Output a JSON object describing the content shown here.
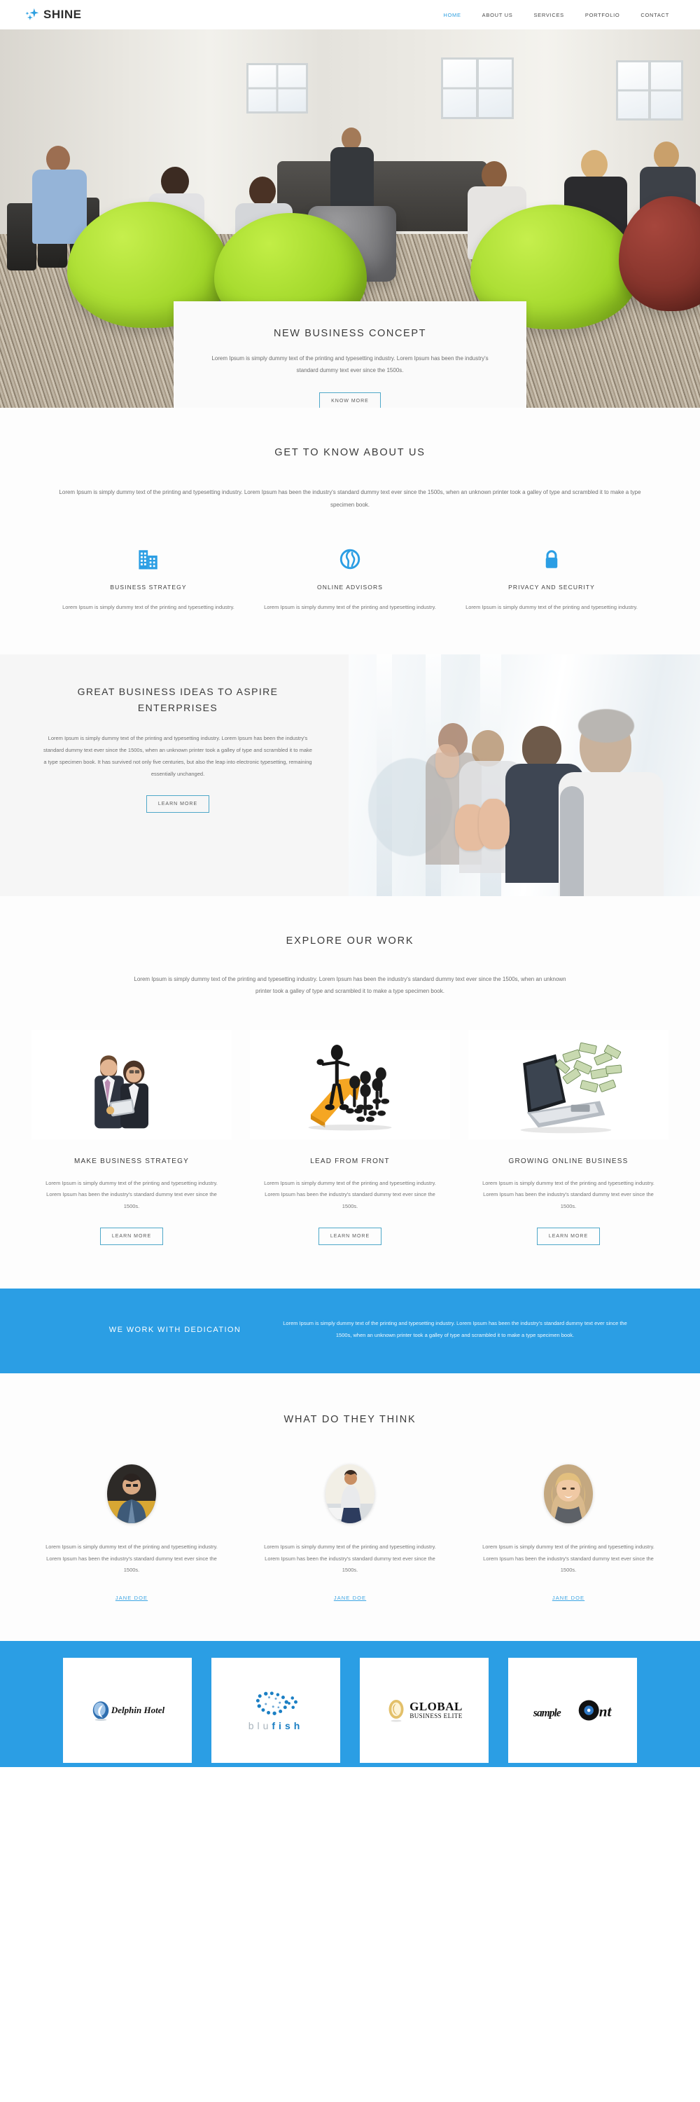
{
  "theme": {
    "accent": "#2b9ee4",
    "accent_light": "#3ea6e4",
    "outline": "#4fa8c9",
    "text_dark": "#3a3a3a",
    "text_muted": "#767676"
  },
  "header": {
    "brand": "SHINE",
    "nav": [
      {
        "label": "HOME",
        "active": true
      },
      {
        "label": "ABOUT US",
        "active": false
      },
      {
        "label": "SERVICES",
        "active": false
      },
      {
        "label": "PORTFOLIO",
        "active": false
      },
      {
        "label": "CONTACT",
        "active": false
      }
    ]
  },
  "hero": {
    "title": "NEW BUSINESS CONCEPT",
    "body": "Lorem Ipsum is simply dummy text of the printing and typesetting industry. Lorem Ipsum has been the industry's standard dummy text ever since the 1500s.",
    "cta": "KNOW MORE"
  },
  "about": {
    "title": "GET TO KNOW ABOUT US",
    "lead": "Lorem Ipsum is simply dummy text of the printing and typesetting industry. Lorem Ipsum has been the industry's standard dummy text ever since the 1500s, when an unknown printer took a galley of type and scrambled it to make a type specimen book.",
    "features": [
      {
        "icon": "building-icon",
        "title": "BUSINESS STRATEGY",
        "body": "Lorem Ipsum is simply dummy text of the printing and typesetting industry."
      },
      {
        "icon": "globe-icon",
        "title": "ONLINE ADVISORS",
        "body": "Lorem Ipsum is simply dummy text of the printing and typesetting industry."
      },
      {
        "icon": "lock-icon",
        "title": "PRIVACY AND SECURITY",
        "body": "Lorem Ipsum is simply dummy text of the printing and typesetting industry."
      }
    ]
  },
  "ideas": {
    "title": "GREAT BUSINESS IDEAS TO ASPIRE ENTERPRISES",
    "body": "Lorem Ipsum is simply dummy text of the printing and typesetting industry. Lorem Ipsum has been the industry's standard dummy text ever since the 1500s, when an unknown printer took a galley of type and scrambled it to make a type specimen book. It has survived not only five centuries, but also the leap into electronic typesetting, remaining essentially unchanged.",
    "cta": "LEARN MORE",
    "image_alt": "applauding-audience-photo"
  },
  "work": {
    "title": "EXPLORE OUR WORK",
    "lead": "Lorem Ipsum is simply dummy text of the printing and typesetting industry. Lorem Ipsum has been the industry's standard dummy text ever since the 1500s, when an unknown printer took a galley of type and scrambled it to make a type specimen book.",
    "cards": [
      {
        "image_alt": "two-businesspeople-with-tablet-photo",
        "title": "MAKE BUSINESS STRATEGY",
        "body": "Lorem Ipsum is simply dummy text of the printing and typesetting industry. Lorem Ipsum has been the industry's standard dummy text ever since the 1500s.",
        "cta": "LEARN MORE"
      },
      {
        "image_alt": "figures-on-orange-arrow-illustration",
        "title": "LEAD FROM FRONT",
        "body": "Lorem Ipsum is simply dummy text of the printing and typesetting industry. Lorem Ipsum has been the industry's standard dummy text ever since the 1500s.",
        "cta": "LEARN MORE"
      },
      {
        "image_alt": "laptop-with-flying-money-photo",
        "title": "GROWING ONLINE BUSINESS",
        "body": "Lorem Ipsum is simply dummy text of the printing and typesetting industry. Lorem Ipsum has been the industry's standard dummy text ever since the 1500s.",
        "cta": "LEARN MORE"
      }
    ]
  },
  "dedication": {
    "title": "WE WORK WITH DEDICATION",
    "body": "Lorem Ipsum is simply dummy text of the printing and typesetting industry. Lorem Ipsum has been the industry's standard dummy text ever since the 1500s, when an unknown printer took a galley of type and scrambled it to make a type specimen book."
  },
  "testimonials": {
    "title": "WHAT DO THEY THINK",
    "items": [
      {
        "avatar_alt": "man-in-blue-shirt-avatar",
        "body": "Lorem Ipsum is simply dummy text of the printing and typesetting industry. Lorem Ipsum has been the industry's standard dummy text ever since the 1500s.",
        "name": "JANE DOE"
      },
      {
        "avatar_alt": "person-sitting-on-car-avatar",
        "body": "Lorem Ipsum is simply dummy text of the printing and typesetting industry. Lorem Ipsum has been the industry's standard dummy text ever since the 1500s.",
        "name": "JANE DOE"
      },
      {
        "avatar_alt": "smiling-blonde-woman-avatar",
        "body": "Lorem Ipsum is simply dummy text of the printing and typesetting industry. Lorem Ipsum has been the industry's standard dummy text ever since the 1500s.",
        "name": "JANE DOE"
      }
    ]
  },
  "clients": [
    {
      "name": "Delphin Hotel",
      "logo": "dolphin-hotel-logo"
    },
    {
      "name": "blufish",
      "logo": "blufish-logo",
      "dim": "blu",
      "hot": "fish"
    },
    {
      "name": "GLOBAL BUSINESS ELITE",
      "logo": "global-business-elite-logo",
      "line1": "GLOBAL",
      "line2": "BUSINESS ELITE"
    },
    {
      "name": "sample",
      "logo": "sample-logo"
    }
  ]
}
